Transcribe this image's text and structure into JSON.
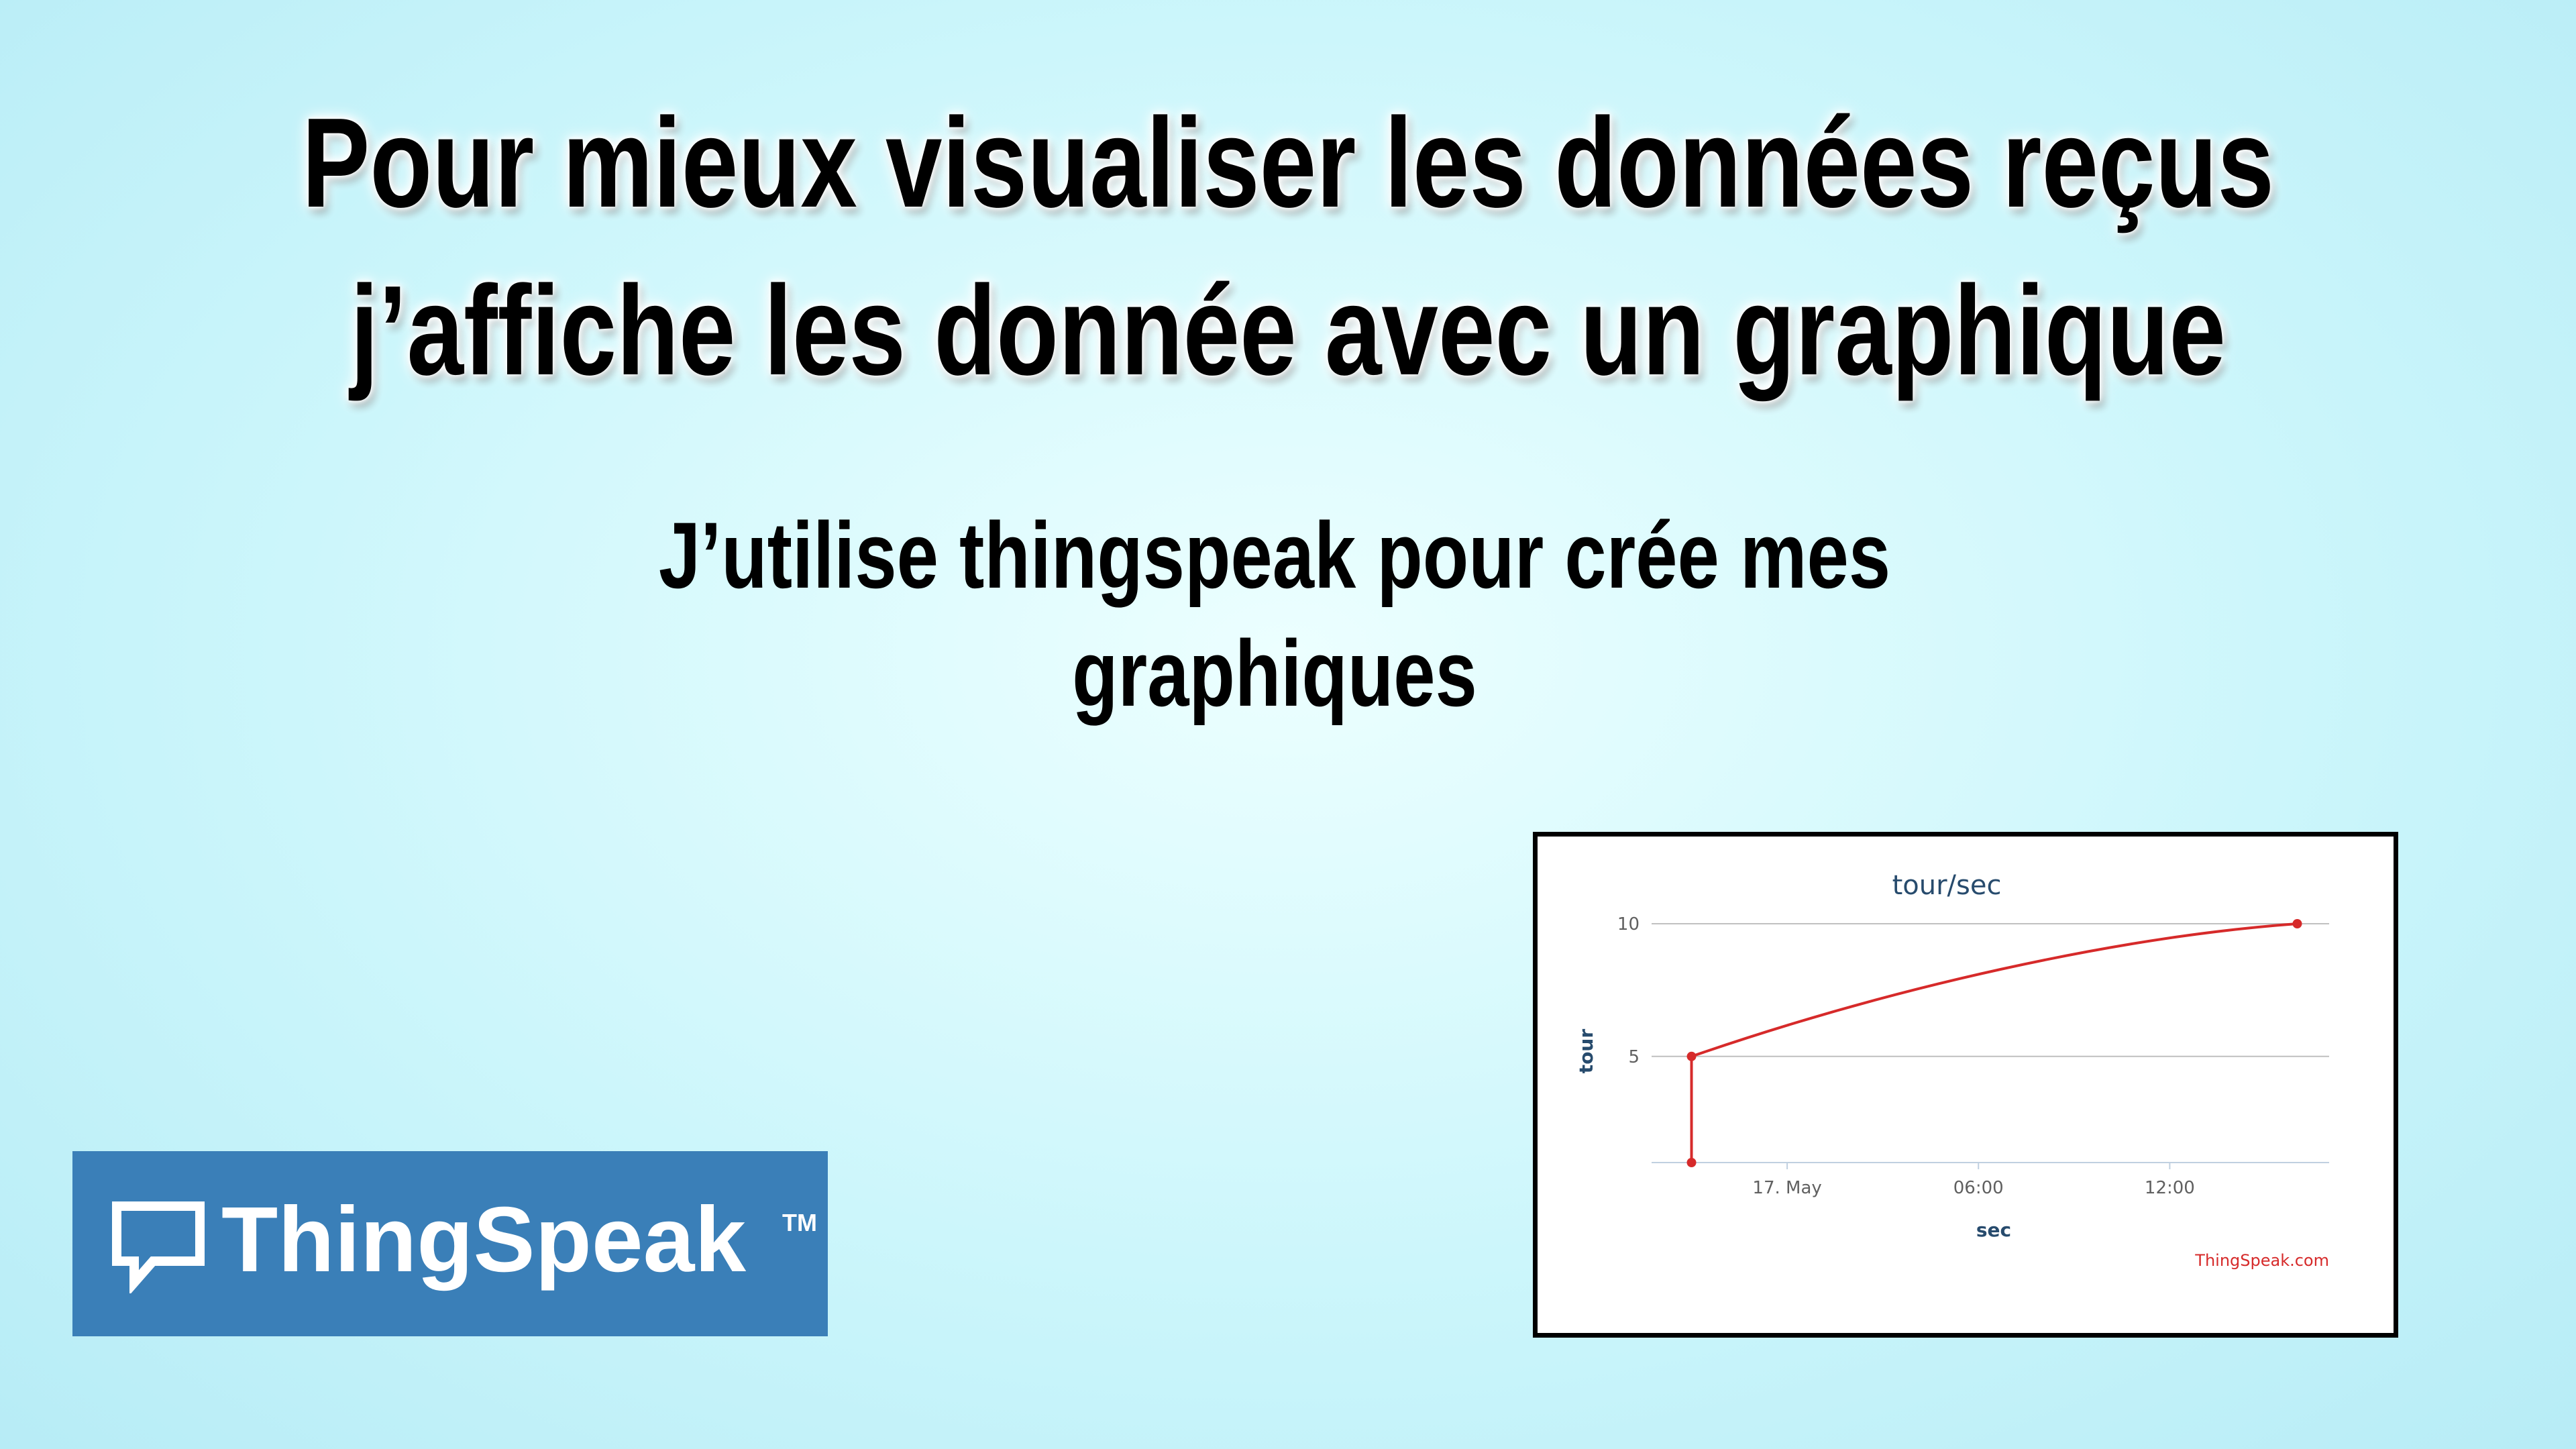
{
  "headline": {
    "line1": "Pour mieux visualiser les données reçus",
    "line2": "j’affiche les donnée avec un graphique"
  },
  "subhead": {
    "line1": "J’utilise thingspeak pour crée mes",
    "line2": "graphiques"
  },
  "logo": {
    "icon": "speech-bubble-icon",
    "text": "ThingSpeak",
    "trademark": "TM",
    "background": "#3a7fb8"
  },
  "chart_data": {
    "type": "line",
    "title": "tour/sec",
    "xlabel": "sec",
    "ylabel": "tour",
    "credit": "ThingSpeak.com",
    "x_ticks": [
      "17. May",
      "06:00",
      "12:00"
    ],
    "y_ticks": [
      5,
      10
    ],
    "ylim": [
      1,
      10
    ],
    "grid": true,
    "line_color": "#d62a2a",
    "series": [
      {
        "points": [
          {
            "x": "16 May 21:00",
            "y": 1
          },
          {
            "x": "16 May 21:00",
            "y": 5
          },
          {
            "x": "17 May 16:00",
            "y": 10
          }
        ]
      }
    ]
  }
}
